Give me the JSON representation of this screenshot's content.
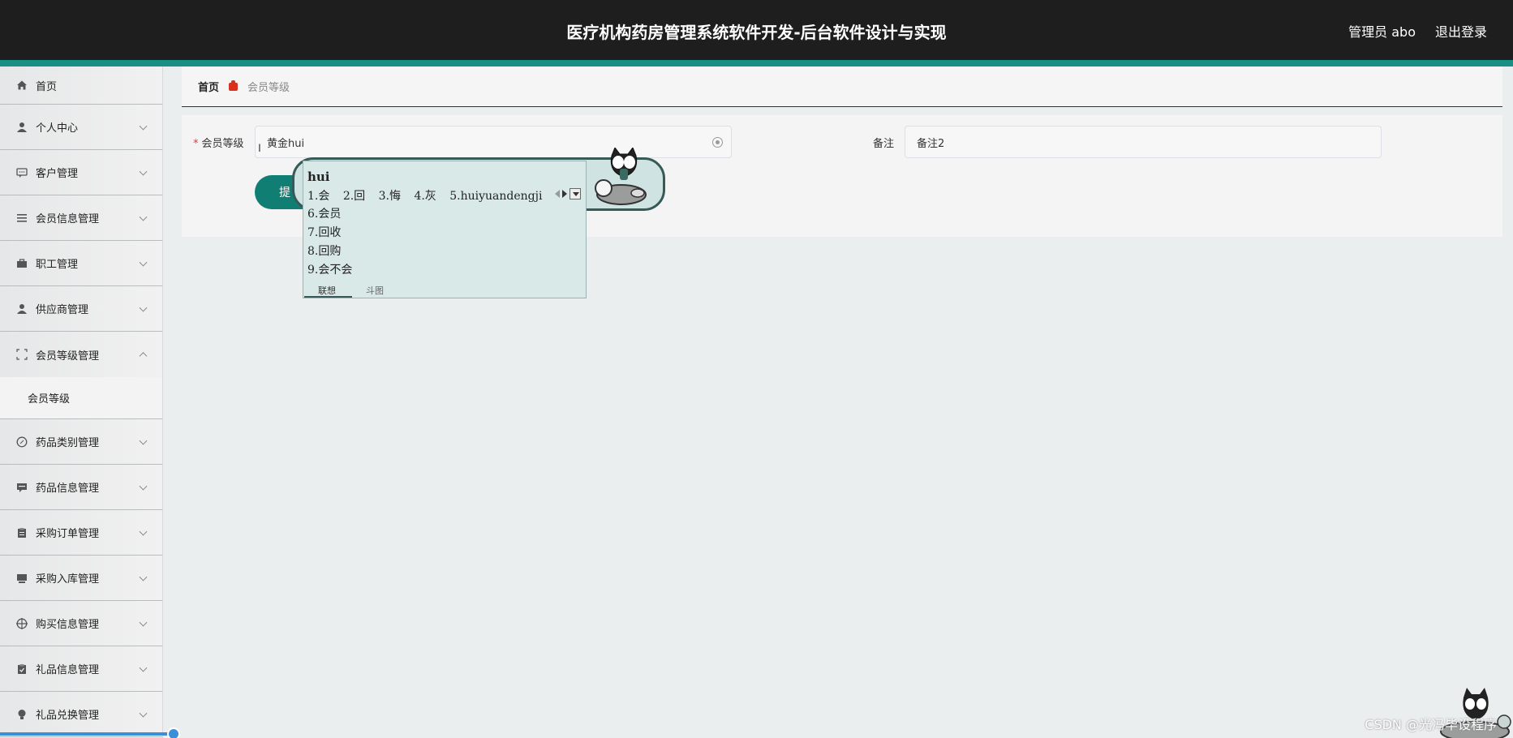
{
  "header": {
    "title": "医疗机构药房管理系统软件开发-后台软件设计与实现",
    "user": "管理员 abo",
    "logout": "退出登录"
  },
  "sidebar": {
    "items": [
      {
        "label": "首页",
        "icon": "home-icon"
      },
      {
        "label": "个人中心",
        "icon": "user-icon"
      },
      {
        "label": "客户管理",
        "icon": "chat-icon"
      },
      {
        "label": "会员信息管理",
        "icon": "list-icon"
      },
      {
        "label": "职工管理",
        "icon": "briefcase-icon"
      },
      {
        "label": "供应商管理",
        "icon": "user-icon"
      },
      {
        "label": "会员等级管理",
        "icon": "expand-icon"
      },
      {
        "label": "药品类别管理",
        "icon": "compass-icon"
      },
      {
        "label": "药品信息管理",
        "icon": "message-icon"
      },
      {
        "label": "采购订单管理",
        "icon": "clipboard-icon"
      },
      {
        "label": "采购入库管理",
        "icon": "monitor-icon"
      },
      {
        "label": "购买信息管理",
        "icon": "target-icon"
      },
      {
        "label": "礼品信息管理",
        "icon": "check-clipboard-icon"
      },
      {
        "label": "礼品兑换管理",
        "icon": "bulb-icon"
      }
    ],
    "sub_item": "会员等级"
  },
  "breadcrumb": {
    "home": "首页",
    "current": "会员等级"
  },
  "form": {
    "level_label": "会员等级",
    "level_value": "黄金hui",
    "remark_label": "备注",
    "remark_value": "备注2",
    "submit_label": "提"
  },
  "ime": {
    "pinyin": "hui",
    "row1": [
      "1.会",
      "2.回",
      "3.悔",
      "4.灰",
      "5.huiyuandengji"
    ],
    "list": [
      "6.会员",
      "7.回收",
      "8.回购",
      "9.会不会"
    ],
    "tabs": [
      "联想",
      "斗图"
    ]
  },
  "watermark": "CSDN @光冯毕设程序"
}
